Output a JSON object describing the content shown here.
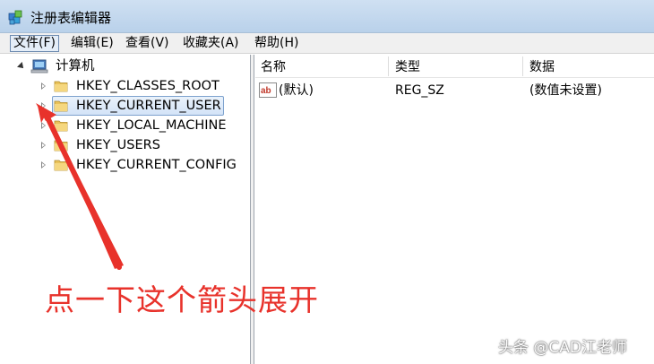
{
  "window": {
    "title": "注册表编辑器"
  },
  "menu": [
    {
      "label": "文件(F)",
      "active": true
    },
    {
      "label": "编辑(E)"
    },
    {
      "label": "查看(V)"
    },
    {
      "label": "收藏夹(A)"
    },
    {
      "label": "帮助(H)"
    }
  ],
  "tree": {
    "root": {
      "label": "计算机",
      "icon": "computer-icon"
    },
    "children": [
      {
        "label": "HKEY_CLASSES_ROOT",
        "icon": "folder-icon"
      },
      {
        "label": "HKEY_CURRENT_USER",
        "icon": "folder-icon",
        "selected": true
      },
      {
        "label": "HKEY_LOCAL_MACHINE",
        "icon": "folder-icon"
      },
      {
        "label": "HKEY_USERS",
        "icon": "folder-icon"
      },
      {
        "label": "HKEY_CURRENT_CONFIG",
        "icon": "folder-icon"
      }
    ]
  },
  "list": {
    "columns": [
      "名称",
      "类型",
      "数据"
    ],
    "rows": [
      {
        "name": "(默认)",
        "type": "REG_SZ",
        "data": "(数值未设置)",
        "icon": "string-value-icon"
      }
    ]
  },
  "annotation": {
    "text": "点一下这个箭头展开",
    "color": "#e8322b"
  },
  "watermark": {
    "text": "头条 @CAD江老师"
  },
  "colors": {
    "selection": "#d3e3f7",
    "titlebar": "#c4d8ee",
    "arrow": "#e8322b"
  }
}
